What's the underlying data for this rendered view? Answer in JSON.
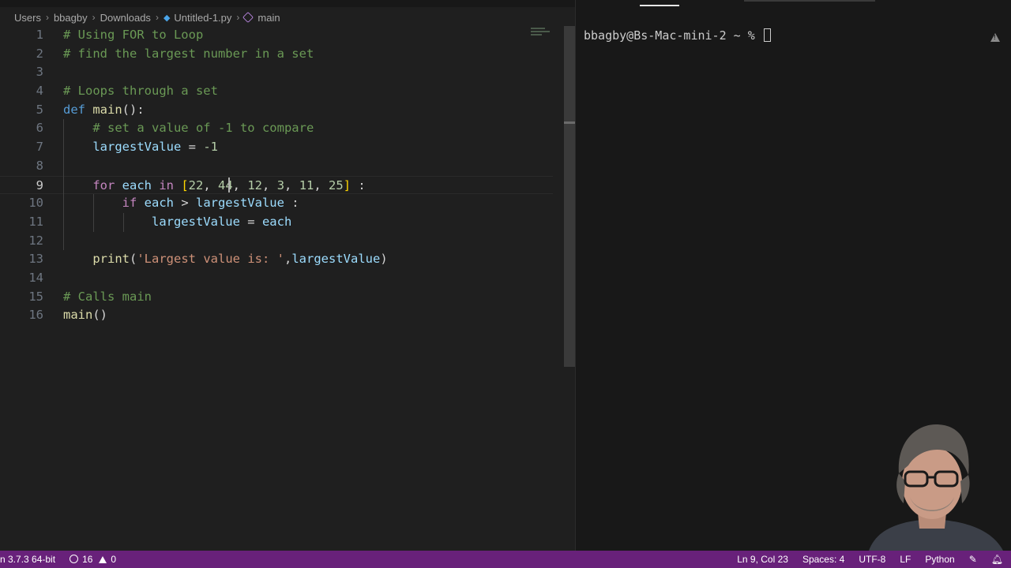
{
  "breadcrumb": {
    "items": [
      "Users",
      "bbagby",
      "Downloads",
      "Untitled-1.py",
      "main"
    ]
  },
  "editor": {
    "lines": [
      {
        "num": "1",
        "tokens": [
          [
            "c",
            "# Using FOR to Loop"
          ]
        ]
      },
      {
        "num": "2",
        "tokens": [
          [
            "c",
            "# find the largest number in a set"
          ]
        ]
      },
      {
        "num": "3",
        "tokens": []
      },
      {
        "num": "4",
        "tokens": [
          [
            "c",
            "# Loops through a set"
          ]
        ]
      },
      {
        "num": "5",
        "tokens": [
          [
            "k",
            "def "
          ],
          [
            "f",
            "main"
          ],
          [
            "p",
            "():"
          ]
        ]
      },
      {
        "num": "6",
        "tokens": [
          [
            "p",
            "    "
          ],
          [
            "c",
            "# set a value of -1 to compare"
          ]
        ]
      },
      {
        "num": "7",
        "tokens": [
          [
            "p",
            "    "
          ],
          [
            "v",
            "largestValue"
          ],
          [
            "p",
            " = "
          ],
          [
            "n",
            "-1"
          ]
        ]
      },
      {
        "num": "8",
        "tokens": []
      },
      {
        "num": "9",
        "tokens": [
          [
            "p",
            "    "
          ],
          [
            "kc",
            "for "
          ],
          [
            "v",
            "each"
          ],
          [
            "kc",
            " in "
          ],
          [
            "br",
            "["
          ],
          [
            "n",
            "22"
          ],
          [
            "p",
            ", "
          ],
          [
            "n",
            "44"
          ],
          [
            "p",
            ", "
          ],
          [
            "n",
            "12"
          ],
          [
            "p",
            ", "
          ],
          [
            "n",
            "3"
          ],
          [
            "p",
            ", "
          ],
          [
            "n",
            "11"
          ],
          [
            "p",
            ", "
          ],
          [
            "n",
            "25"
          ],
          [
            "br",
            "]"
          ],
          [
            "p",
            " :"
          ]
        ]
      },
      {
        "num": "10",
        "tokens": [
          [
            "p",
            "        "
          ],
          [
            "kc",
            "if "
          ],
          [
            "v",
            "each"
          ],
          [
            "p",
            " > "
          ],
          [
            "v",
            "largestValue"
          ],
          [
            "p",
            " :"
          ]
        ]
      },
      {
        "num": "11",
        "tokens": [
          [
            "p",
            "            "
          ],
          [
            "v",
            "largestValue"
          ],
          [
            "p",
            " = "
          ],
          [
            "v",
            "each"
          ]
        ]
      },
      {
        "num": "12",
        "tokens": []
      },
      {
        "num": "13",
        "tokens": [
          [
            "p",
            "    "
          ],
          [
            "f",
            "print"
          ],
          [
            "p",
            "("
          ],
          [
            "s",
            "'Largest value is: '"
          ],
          [
            "p",
            ","
          ],
          [
            "v",
            "largestValue"
          ],
          [
            "p",
            ")"
          ]
        ]
      },
      {
        "num": "14",
        "tokens": []
      },
      {
        "num": "15",
        "tokens": [
          [
            "c",
            "# Calls main"
          ]
        ]
      },
      {
        "num": "16",
        "tokens": [
          [
            "f",
            "main"
          ],
          [
            "p",
            "()"
          ]
        ]
      }
    ]
  },
  "terminal": {
    "prompt": "bbagby@Bs-Mac-mini-2 ~ % "
  },
  "statusbar": {
    "interpreter": "n 3.7.3 64-bit",
    "errors": "16",
    "warnings": "0",
    "position": "Ln 9, Col 23",
    "spaces": "Spaces: 4",
    "encoding": "UTF-8",
    "eol": "LF",
    "language": "Python"
  },
  "colors": {
    "statusbar_bg": "#68217a",
    "editor_bg": "#1f1f1f",
    "terminal_bg": "#181818",
    "comment": "#6a9955",
    "keyword": "#569cd6",
    "control": "#c586c0",
    "function": "#dcdcaa",
    "variable": "#9cdcfe",
    "number": "#b5cea8",
    "string": "#ce9178"
  }
}
